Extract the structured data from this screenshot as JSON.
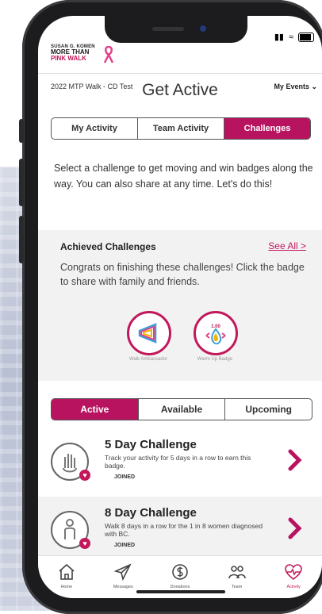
{
  "header": {
    "logo_line1": "SUSAN G. KOMEN",
    "logo_line2": "MORE THAN",
    "logo_line3": "PINK WALK",
    "event_name": "2022 MTP Walk - CD Test",
    "my_events": "My Events ⌄"
  },
  "page": {
    "title": "Get Active",
    "tabs": [
      "My Activity",
      "Team Activity",
      "Challenges"
    ],
    "intro": "Select a challenge to get moving and win badges along the way. You can also share at any time. Let's do this!"
  },
  "achieved": {
    "title": "Achieved Challenges",
    "see_all": "See All >",
    "text": "Congrats on finishing these challenges! Click the badge to share with family and friends.",
    "badges": [
      {
        "label": "Walk Ambassador"
      },
      {
        "label": "Warm Up Badge",
        "top_text": "1.00"
      }
    ]
  },
  "challenge_tabs": [
    "Active",
    "Available",
    "Upcoming"
  ],
  "challenges": [
    {
      "title": "5 Day Challenge",
      "desc": "Track your activity for 5 days in a row to earn this badge.",
      "status": "JOINED"
    },
    {
      "title": "8 Day Challenge",
      "desc": "Walk 8 days in a row for the 1 in 8 women diagnosed with BC.",
      "status": "JOINED"
    }
  ],
  "nav": [
    {
      "label": "Home",
      "icon": "home-icon"
    },
    {
      "label": "Messages",
      "icon": "send-icon"
    },
    {
      "label": "Donations",
      "icon": "dollar-icon"
    },
    {
      "label": "Team",
      "icon": "team-icon"
    },
    {
      "label": "Activity",
      "icon": "activity-heart-icon"
    }
  ],
  "colors": {
    "accent": "#b8135f",
    "phone_frame": "#1c1c1e"
  }
}
